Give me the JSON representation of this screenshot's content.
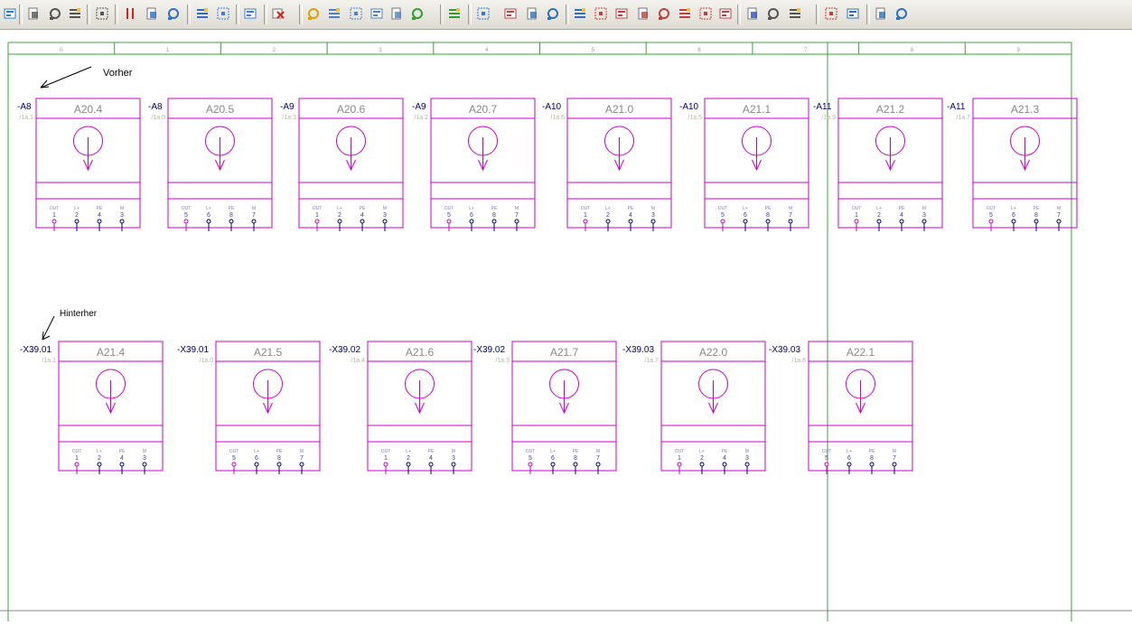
{
  "toolbar": {
    "buttons": [
      {
        "icon": "network-icon",
        "color": "#2a7fd0"
      },
      {
        "icon": "sort-numbers-icon",
        "color": "#555555"
      },
      {
        "icon": "number-order-icon",
        "color": "#555555"
      },
      {
        "icon": "number-list-icon",
        "color": "#555555"
      },
      {
        "icon": "number-reverse-icon",
        "color": "#555555"
      },
      {
        "icon": "pause-red-icon",
        "color": "#d42020"
      },
      {
        "icon": "layers-icon",
        "color": "#2d6fc9"
      },
      {
        "icon": "layers-edit-icon",
        "color": "#2d6fc9"
      },
      {
        "icon": "layers-back-icon",
        "color": "#2d6fc9"
      },
      {
        "icon": "page-grid-icon",
        "color": "#3b7dd8"
      },
      {
        "icon": "page-move-icon",
        "color": "#3b7dd8"
      },
      {
        "icon": "delete-x-icon",
        "color": "#d42020"
      },
      {
        "icon": "book-icon",
        "color": "#e0a000"
      },
      {
        "icon": "copy-icon",
        "color": "#4d82c4"
      },
      {
        "icon": "new-page-icon",
        "color": "#4d82c4"
      },
      {
        "icon": "page-edit-icon",
        "color": "#4d82c4"
      },
      {
        "icon": "page-rotate-icon",
        "color": "#4d82c4"
      },
      {
        "icon": "page-import-icon",
        "color": "#2e9e2e"
      },
      {
        "icon": "page-export-icon",
        "color": "#2e9e2e"
      },
      {
        "icon": "table-icon",
        "color": "#2e7ad0"
      },
      {
        "icon": "list-edit-icon",
        "color": "#c04040"
      },
      {
        "icon": "select-box-icon",
        "color": "#2e6fc0"
      },
      {
        "icon": "select-center-icon",
        "color": "#2e6fc0"
      },
      {
        "icon": "select-fit-icon",
        "color": "#2e6fc0"
      },
      {
        "icon": "wire-grid-icon",
        "color": "#c04040"
      },
      {
        "icon": "branch-icon",
        "color": "#c04040"
      },
      {
        "icon": "branch-alt-icon",
        "color": "#c04040"
      },
      {
        "icon": "branch-circle-icon",
        "color": "#c04040"
      },
      {
        "icon": "branch-dot-icon",
        "color": "#c04040"
      },
      {
        "icon": "connector-icon",
        "color": "#c04040"
      },
      {
        "icon": "connector-alt-icon",
        "color": "#c04040"
      },
      {
        "icon": "wave-icon",
        "color": "#3050c0"
      },
      {
        "icon": "properties-icon",
        "color": "#555555"
      },
      {
        "icon": "hatch-icon",
        "color": "#555555"
      },
      {
        "icon": "frame-icon",
        "color": "#c04040"
      },
      {
        "icon": "window-icon",
        "color": "#2e6fc0"
      },
      {
        "icon": "zoom-fit-icon",
        "color": "#2e6fc0"
      },
      {
        "icon": "cart-icon",
        "color": "#2e6fc0"
      },
      {
        "icon": "report-icon",
        "color": "#c04040"
      }
    ]
  },
  "ruler": {
    "columns": [
      "0",
      "1",
      "2",
      "3",
      "4",
      "5",
      "6",
      "7",
      "8",
      "9"
    ]
  },
  "annotations": {
    "before": "Vorher",
    "after": "Hinterher"
  },
  "colors": {
    "component": "#cc00cc",
    "tag": "#000080",
    "ref": "#b8b4a0",
    "frame": "#3aa03a",
    "arrow": "#000000"
  },
  "row1": [
    {
      "tag": "-A8",
      "ref": "/1a.1",
      "name": "A20.4",
      "pins": [
        "1",
        "2",
        "4",
        "3"
      ],
      "pin_labels": [
        "OUT",
        "L+",
        "PE",
        "M"
      ]
    },
    {
      "tag": "-A8",
      "ref": "/1a.0",
      "name": "A20.5",
      "pins": [
        "5",
        "6",
        "8",
        "7"
      ],
      "pin_labels": [
        "OUT",
        "L+",
        "PE",
        "M"
      ]
    },
    {
      "tag": "-A9",
      "ref": "/1a.3",
      "name": "A20.6",
      "pins": [
        "1",
        "2",
        "4",
        "3"
      ],
      "pin_labels": [
        "OUT",
        "L+",
        "PE",
        "M"
      ]
    },
    {
      "tag": "-A9",
      "ref": "/1a.2",
      "name": "A20.7",
      "pins": [
        "5",
        "6",
        "8",
        "7"
      ],
      "pin_labels": [
        "OUT",
        "L+",
        "PE",
        "M"
      ]
    },
    {
      "tag": "-A10",
      "ref": "/1a.6",
      "name": "A21.0",
      "pins": [
        "1",
        "2",
        "4",
        "3"
      ],
      "pin_labels": [
        "OUT",
        "L+",
        "PE",
        "M"
      ]
    },
    {
      "tag": "-A10",
      "ref": "/1a.5",
      "name": "A21.1",
      "pins": [
        "5",
        "6",
        "8",
        "7"
      ],
      "pin_labels": [
        "OUT",
        "L+",
        "PE",
        "M"
      ]
    },
    {
      "tag": "-A11",
      "ref": "/1a.9",
      "name": "A21.2",
      "pins": [
        "1",
        "2",
        "4",
        "3"
      ],
      "pin_labels": [
        "OUT",
        "L+",
        "PE",
        "M"
      ]
    },
    {
      "tag": "-A11",
      "ref": "/1a.7",
      "name": "A21.3",
      "pins": [
        "5",
        "6",
        "8",
        "7"
      ],
      "pin_labels": [
        "OUT",
        "L+",
        "PE",
        "M"
      ]
    }
  ],
  "row2": [
    {
      "tag": "-X39.01",
      "ref": "/1a.1",
      "name": "A21.4",
      "pins": [
        "1",
        "2",
        "4",
        "3"
      ],
      "pin_labels": [
        "OUT",
        "L+",
        "PE",
        "M"
      ]
    },
    {
      "tag": "-X39.01",
      "ref": "/1a.0",
      "name": "A21.5",
      "pins": [
        "5",
        "6",
        "8",
        "7"
      ],
      "pin_labels": [
        "OUT",
        "L+",
        "PE",
        "M"
      ]
    },
    {
      "tag": "-X39.02",
      "ref": "/1a.4",
      "name": "A21.6",
      "pins": [
        "1",
        "2",
        "4",
        "3"
      ],
      "pin_labels": [
        "OUT",
        "L+",
        "PE",
        "M"
      ]
    },
    {
      "tag": "-X39.02",
      "ref": "/1a.3",
      "name": "A21.7",
      "pins": [
        "5",
        "6",
        "8",
        "7"
      ],
      "pin_labels": [
        "OUT",
        "L+",
        "PE",
        "M"
      ]
    },
    {
      "tag": "-X39.03",
      "ref": "/1a.7",
      "name": "A22.0",
      "pins": [
        "1",
        "2",
        "4",
        "3"
      ],
      "pin_labels": [
        "OUT",
        "L+",
        "PE",
        "M"
      ]
    },
    {
      "tag": "-X39.03",
      "ref": "/1a.6",
      "name": "A22.1",
      "pins": [
        "5",
        "6",
        "8",
        "7"
      ],
      "pin_labels": [
        "OUT",
        "L+",
        "PE",
        "M"
      ]
    }
  ]
}
